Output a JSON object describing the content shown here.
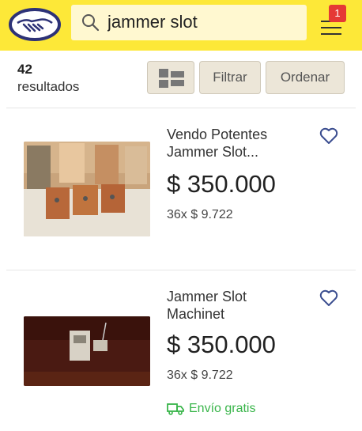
{
  "header": {
    "search_value": "jammer slot",
    "notification_count": "1",
    "colors": {
      "bar": "#fde838",
      "badge": "#e53935"
    }
  },
  "toolbar": {
    "result_count": "42",
    "result_label": "resultados",
    "filter_label": "Filtrar",
    "order_label": "Ordenar"
  },
  "results": [
    {
      "title_line1": "Vendo Potentes",
      "title_line2": "Jammer Slot...",
      "price": "$ 350.000",
      "installments": "36x $ 9.722"
    },
    {
      "title_line1": "Jammer Slot",
      "title_line2": "Machinet",
      "price": "$ 350.000",
      "installments": "36x $ 9.722",
      "shipping": "Envío gratis"
    }
  ]
}
